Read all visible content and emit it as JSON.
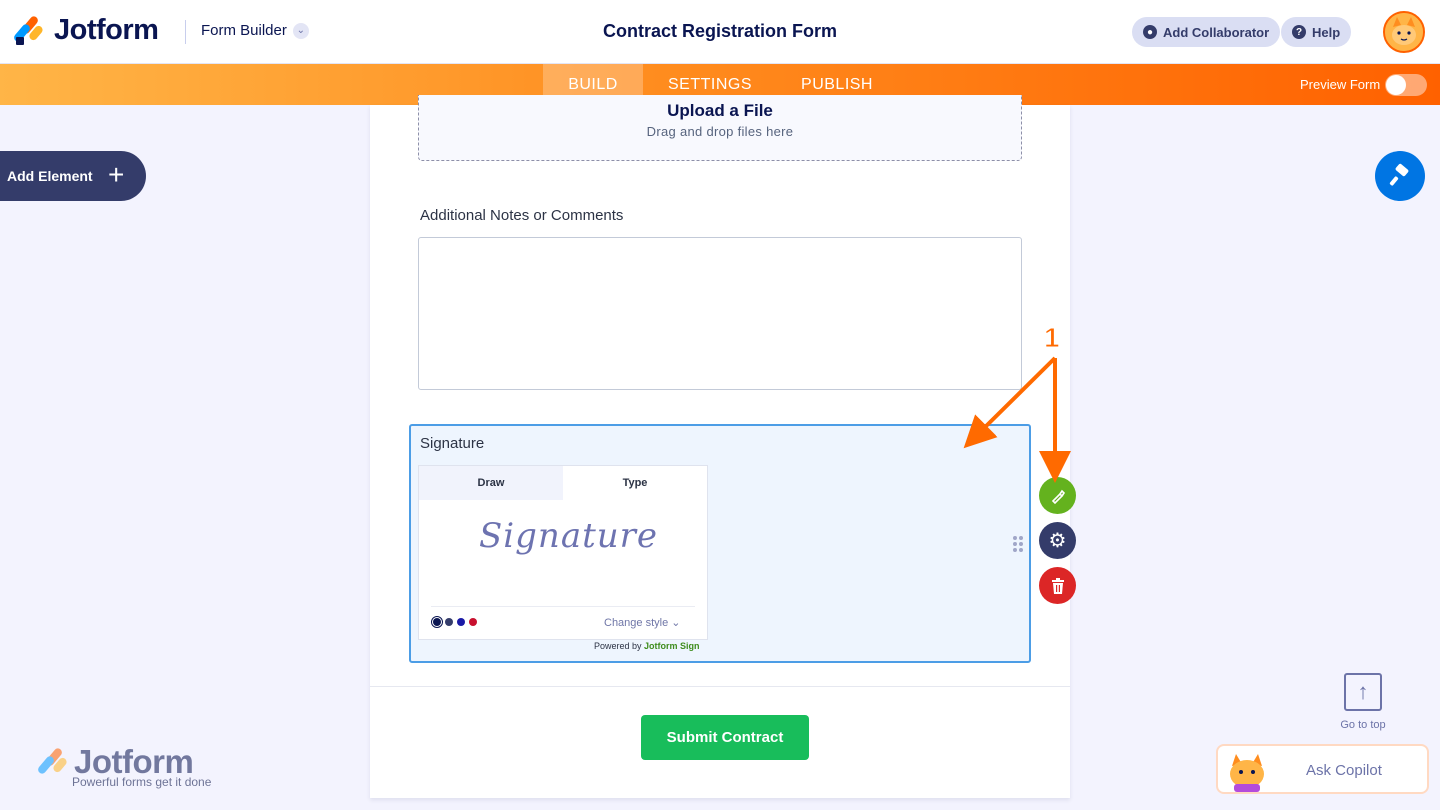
{
  "header": {
    "logo_text": "Jotform",
    "builder_label": "Form Builder",
    "page_title": "Contract Registration Form",
    "add_collaborator": "Add Collaborator",
    "help": "Help"
  },
  "nav": {
    "tabs": [
      {
        "label": "BUILD",
        "active": true
      },
      {
        "label": "SETTINGS",
        "active": false
      },
      {
        "label": "PUBLISH",
        "active": false
      }
    ],
    "preview_label": "Preview Form",
    "preview_on": false
  },
  "left_panel": {
    "add_element": "Add Element"
  },
  "form": {
    "upload": {
      "title": "Upload a File",
      "subtitle": "Drag and drop files here"
    },
    "notes": {
      "label": "Additional Notes or Comments",
      "value": ""
    },
    "signature": {
      "label": "Signature",
      "tabs": [
        "Draw",
        "Type"
      ],
      "active_tab": "Type",
      "sample_text": "Signature",
      "change_style": "Change style",
      "powered_prefix": "Powered by",
      "powered_brand": "Jotform Sign",
      "ink_colors": [
        "#0a1551",
        "#343c6a",
        "#1a1aa6",
        "#c8102e"
      ]
    },
    "submit_label": "Submit Contract"
  },
  "field_actions": {
    "icons": [
      "sign-icon",
      "gear-icon",
      "trash-icon"
    ],
    "colors": [
      "#64b21e",
      "#343c6a",
      "#dc2626"
    ]
  },
  "annotation": {
    "number": "1",
    "color": "#ff6a00"
  },
  "footer": {
    "brand_text": "Jotform",
    "brand_tagline": "Powerful forms get it done",
    "go_to_top": "Go to top",
    "ask_copilot": "Ask Copilot"
  },
  "colors": {
    "brand_navy": "#0a1551",
    "accent_orange": "#ff6100",
    "submit_green": "#18bd5b",
    "selection_blue": "#4c9de6"
  }
}
